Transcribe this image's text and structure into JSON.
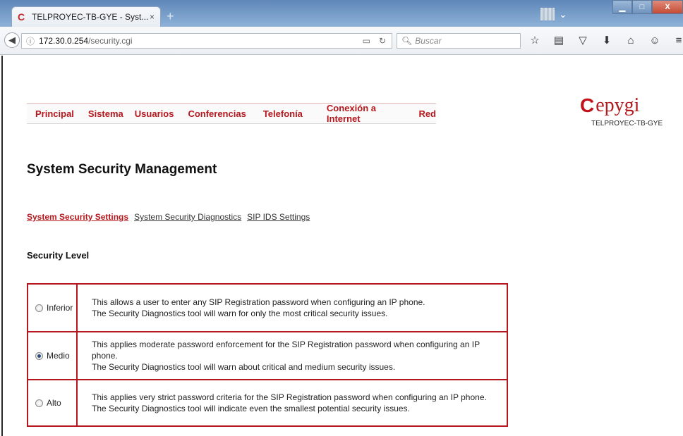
{
  "browser": {
    "tab_title": "TELPROYEC-TB-GYE - Syst...",
    "tab_close": "×",
    "new_tab": "+",
    "url_host": "172.30.0.254",
    "url_path": "/security.cgi",
    "search_placeholder": "Buscar",
    "window_buttons": {
      "minimize": "▁",
      "maximize": "□",
      "close": "X"
    }
  },
  "menu": {
    "items": [
      "Principal",
      "Sistema",
      "Usuarios",
      "Conferencias",
      "Telefonía",
      "Conexión a Internet",
      "Red"
    ]
  },
  "logo": {
    "brand": "epygi",
    "device_name": "TELPROYEC-TB-GYE"
  },
  "page": {
    "title": "System Security Management",
    "subtabs": [
      "System Security Settings",
      "System Security Diagnostics",
      "SIP IDS Settings"
    ],
    "active_subtab": "System Security Settings",
    "section_label": "Security Level"
  },
  "levels": [
    {
      "label": "Inferior",
      "checked": false,
      "line1": "This allows a user to enter any SIP Registration password when configuring an IP phone.",
      "line2": "The Security Diagnostics tool will warn for only the most critical security issues."
    },
    {
      "label": "Medio",
      "checked": true,
      "line1": "This applies moderate password enforcement for the SIP Registration password when configuring an IP phone.",
      "line2": "The Security Diagnostics tool will warn about critical and medium security issues."
    },
    {
      "label": "Alto",
      "checked": false,
      "line1": "This applies very strict password criteria for the SIP Registration password when configuring an IP phone.",
      "line2": "The Security Diagnostics tool will indicate even the smallest potential security issues."
    }
  ],
  "colors": {
    "accent": "#b4171c",
    "titlebar": "#6f93bd"
  }
}
